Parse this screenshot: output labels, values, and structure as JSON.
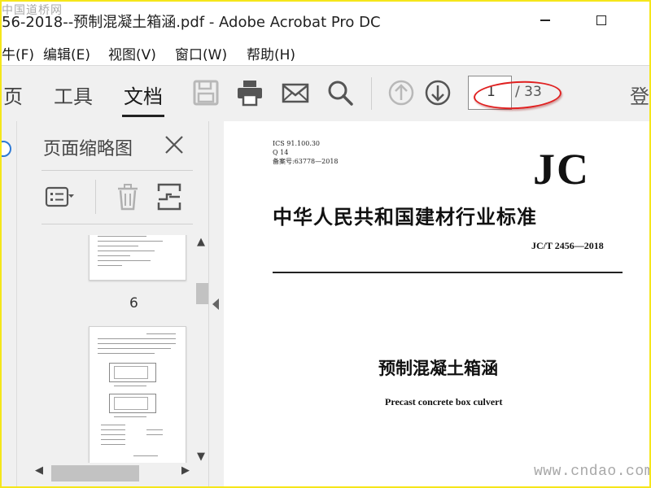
{
  "window": {
    "title": "56-2018--预制混凝土箱涵.pdf - Adobe Acrobat Pro DC"
  },
  "watermark_top": "中国道桥网",
  "menu": {
    "items": [
      "牛(F)",
      "编辑(E)",
      "视图(V)",
      "窗口(W)",
      "帮助(H)"
    ]
  },
  "tabs": [
    {
      "label": "页"
    },
    {
      "label": "工具"
    },
    {
      "label": "文档",
      "active": true
    }
  ],
  "toolbar": {
    "icons": [
      "save-icon",
      "print-icon",
      "mail-icon",
      "search-icon",
      "page-up-icon",
      "page-down-icon"
    ],
    "current_page": "1",
    "total_pages": "/ 33",
    "login_label": "登"
  },
  "sidebar": {
    "title": "页面缩略图",
    "thumbnails": [
      {
        "page_label": "6"
      },
      {
        "page_label": ""
      }
    ]
  },
  "document": {
    "ics_line1": "ICS 91.100.30",
    "ics_line2": "Q 14",
    "ics_line3": "备案号:63778—2018",
    "jc_logo": "JC",
    "heading": "中华人民共和国建材行业标准",
    "standard_number": "JC/T 2456—2018",
    "title_cn": "预制混凝土箱涵",
    "title_en": "Precast concrete box culvert"
  },
  "watermark_bottom": "www.cndao.com",
  "colors": {
    "frame": "#f5e61a",
    "annotation": "#e02020",
    "toolbar_bg": "#f0f0f0"
  }
}
